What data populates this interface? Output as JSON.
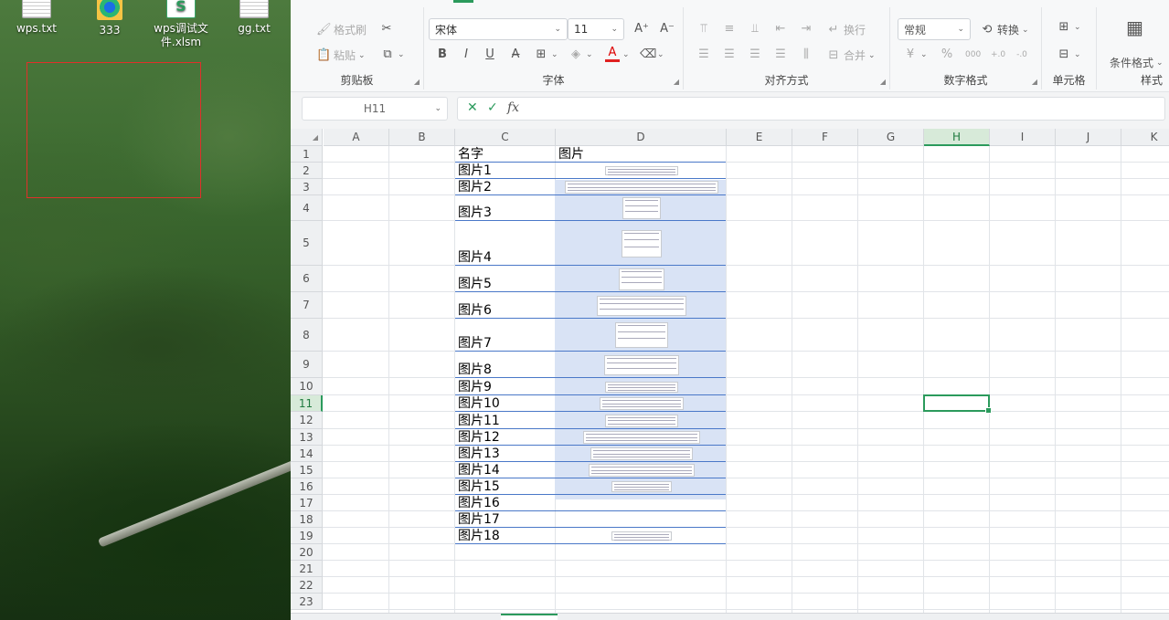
{
  "desktop": {
    "icons": [
      {
        "label": "wps.txt",
        "kind": "txt"
      },
      {
        "label": "333",
        "kind": "edge"
      },
      {
        "label": "wps调试文件.xlsm",
        "kind": "xls"
      },
      {
        "label": "gg.txt",
        "kind": "txt"
      }
    ]
  },
  "ribbon": {
    "clipboard": {
      "format_painter": "格式刷",
      "paste": "粘贴",
      "label": "剪贴板"
    },
    "font": {
      "name": "宋体",
      "size": "11",
      "label": "字体",
      "bold": "B",
      "italic": "I",
      "underline": "U"
    },
    "alignment": {
      "wrap": "换行",
      "merge": "合并",
      "label": "对齐方式"
    },
    "number": {
      "format": "常规",
      "convert": "转换",
      "label": "数字格式"
    },
    "cells": {
      "label": "单元格"
    },
    "styles": {
      "conditional": "条件格式",
      "label": "样式"
    }
  },
  "formula_bar": {
    "name_box": "H11",
    "fx": "fx",
    "value": ""
  },
  "sheet": {
    "columns": [
      "A",
      "B",
      "C",
      "D",
      "E",
      "F",
      "G",
      "H",
      "I",
      "J",
      "K"
    ],
    "rows": [
      "1",
      "2",
      "3",
      "4",
      "5",
      "6",
      "7",
      "8",
      "9",
      "10",
      "11",
      "12",
      "13",
      "14",
      "15",
      "16",
      "17",
      "18",
      "19",
      "20",
      "21",
      "22",
      "23"
    ],
    "active_cell": "H11",
    "header_c": "名字",
    "header_d": "图片",
    "names": [
      "图片1",
      "图片2",
      "图片3",
      "图片4",
      "图片5",
      "图片6",
      "图片7",
      "图片8",
      "图片9",
      "图片10",
      "图片11",
      "图片12",
      "图片13",
      "图片14",
      "图片15",
      "图片16",
      "图片17",
      "图片18"
    ]
  },
  "colors": {
    "accent": "#2b9a5c",
    "selection_rect": "#e0302a",
    "picture_fill": "#d9e3f5"
  }
}
